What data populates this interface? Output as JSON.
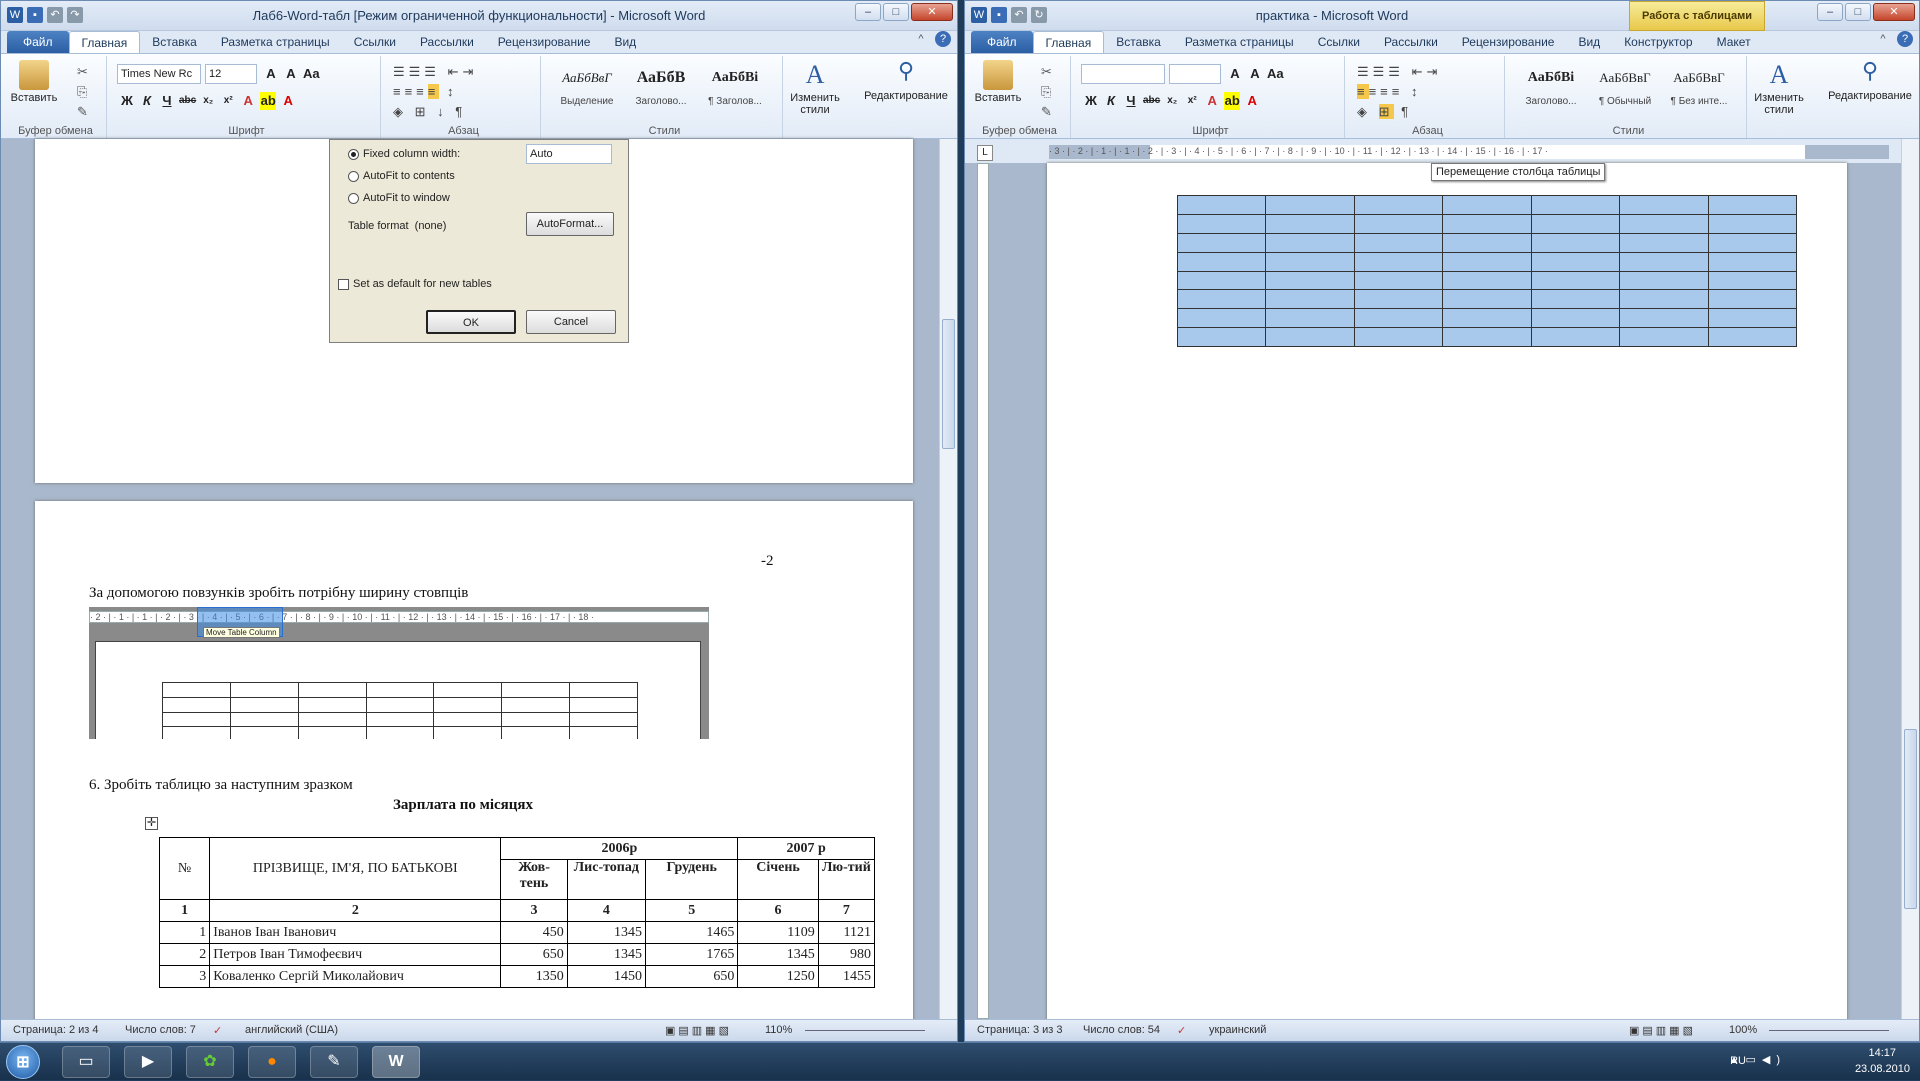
{
  "left_window": {
    "title": "Лаб6-Word-табл [Режим ограниченной функциональности] - Microsoft Word",
    "tabs": [
      "Файл",
      "Главная",
      "Вставка",
      "Разметка страницы",
      "Ссылки",
      "Рассылки",
      "Рецензирование",
      "Вид"
    ],
    "ribbon": {
      "paste": "Вставить",
      "font_name": "Times New Rc",
      "font_size": "12",
      "styles": [
        {
          "preview": "АаБбВвГ",
          "name": "Выделение"
        },
        {
          "preview": "АаБбВ",
          "name": "Заголово..."
        },
        {
          "preview": "АаБбВі",
          "name": "¶ Заголов..."
        }
      ],
      "change_styles": "Изменить стили",
      "editing": "Редактирование",
      "groups": [
        "Буфер обмена",
        "Шрифт",
        "Абзац",
        "Стили"
      ]
    },
    "dialog": {
      "fixed_label": "Fixed column width:",
      "fixed_value": "Auto",
      "autofit_contents": "AutoFit to contents",
      "autofit_window": "AutoFit to window",
      "table_format_label": "Table format",
      "table_format_value": "(none)",
      "autoformat_btn": "AutoFormat...",
      "default_chk": "Set as default for new tables",
      "ok": "OK",
      "cancel": "Cancel"
    },
    "page2": {
      "page_no": "-2",
      "instruction": "За допомогою повзунків зробіть потрібну ширину стовпців",
      "tooltip": "Move Table Column",
      "ruler": "· 2 · | · 1 · | · 1 · | · 2 · | · 3 · | · 4 · | · 5 · | · 6 · | · 7 · | · 8 · | · 9 · | · 10 · | · 11 · | · 12 · | · 13 · | · 14 · | · 15 · | · 16 · | · 17 · | · 18 ·",
      "task6": "6.   Зробіть таблицю за наступним зразком",
      "table_title": "Зарплата по місяцях",
      "table": {
        "h_no": "№",
        "h_name": "ПРІЗВИЩЕ, ІМ'Я, ПО БАТЬКОВІ",
        "h_2006": "2006р",
        "h_2007": "2007 р",
        "months": [
          "Жов-тень",
          "Лис-топад",
          "Грудень",
          "Січень",
          "Лю-тий"
        ],
        "nums": [
          "1",
          "2",
          "3",
          "4",
          "5",
          "6",
          "7"
        ],
        "rows": [
          [
            "1",
            "Іванов Іван Іванович",
            "450",
            "1345",
            "1465",
            "1109",
            "1121"
          ],
          [
            "2",
            "Петров Іван Тимофеєвич",
            "650",
            "1345",
            "1765",
            "1345",
            "980"
          ],
          [
            "3",
            "Коваленко Сергій Миколайович",
            "1350",
            "1450",
            "650",
            "1250",
            "1455"
          ]
        ]
      }
    },
    "status": {
      "page": "Страница: 2 из 4",
      "words": "Число слов: 7",
      "lang": "английский (США)",
      "zoom": "110%"
    }
  },
  "right_window": {
    "title": "практика - Microsoft Word",
    "context_header": "Работа с таблицами",
    "tabs": [
      "Файл",
      "Главная",
      "Вставка",
      "Разметка страницы",
      "Ссылки",
      "Рассылки",
      "Рецензирование",
      "Вид",
      "Конструктор",
      "Макет"
    ],
    "ribbon": {
      "paste": "Вставить",
      "styles": [
        {
          "preview": "АаБбВі",
          "name": "Заголово..."
        },
        {
          "preview": "АаБбВвГ",
          "name": "¶ Обычный"
        },
        {
          "preview": "АаБбВвГ",
          "name": "¶ Без инте..."
        }
      ],
      "change_styles": "Изменить стили",
      "editing": "Редактирование",
      "groups": [
        "Буфер обмена",
        "Шрифт",
        "Абзац",
        "Стили"
      ]
    },
    "ruler": "· 3 · | · 2 · | · 1 · | · 1 · | · 2 · | · 3 · | · 4 · | · 5 · | · 6 · | · 7 · | · 8 · | · 9 · | · 10 · | · 11 · | · 12 · | · 13 · | · 14 · | · 15 · | · 16 · | · 17 ·",
    "tooltip": "Перемещение столбца таблицы",
    "status": {
      "page": "Страница: 3 из 3",
      "words": "Число слов: 54",
      "lang": "украинский",
      "zoom": "100%"
    }
  },
  "taskbar": {
    "lang": "RU",
    "time": "14:17",
    "date": "23.08.2010"
  },
  "colors": {
    "selection": "#a8c8ec",
    "file_tab": "#2b5ea3",
    "ctx": "#e8c84a"
  }
}
